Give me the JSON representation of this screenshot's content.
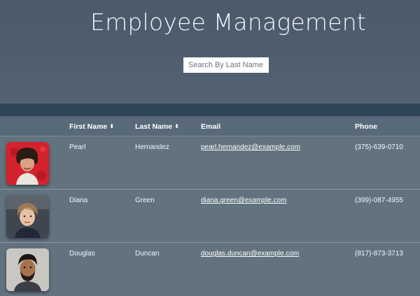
{
  "header": {
    "title": "Employee Management",
    "search_placeholder": "Search By Last Name"
  },
  "table": {
    "columns": [
      {
        "label": "First Name",
        "sortable": true
      },
      {
        "label": "Last Name",
        "sortable": true
      },
      {
        "label": "Email",
        "sortable": false
      },
      {
        "label": "Phone",
        "sortable": false
      }
    ],
    "sort_icon": "⬍",
    "rows": [
      {
        "first_name": "Pearl",
        "last_name": "Hernandez",
        "email": "pearl.hernandez@example.com",
        "phone": "(375)-639-0710",
        "avatar_icon": "person-photo-avatar"
      },
      {
        "first_name": "Diana",
        "last_name": "Green",
        "email": "diana.green@example.com",
        "phone": "(399)-087-4955",
        "avatar_icon": "person-photo-avatar"
      },
      {
        "first_name": "Douglas",
        "last_name": "Duncan",
        "email": "douglas.duncan@example.com",
        "phone": "(817)-873-3713",
        "avatar_icon": "person-photo-avatar"
      }
    ]
  },
  "colors": {
    "hero": "#4f5f70",
    "band": "#2f4558",
    "table": "#5e6f7f"
  }
}
